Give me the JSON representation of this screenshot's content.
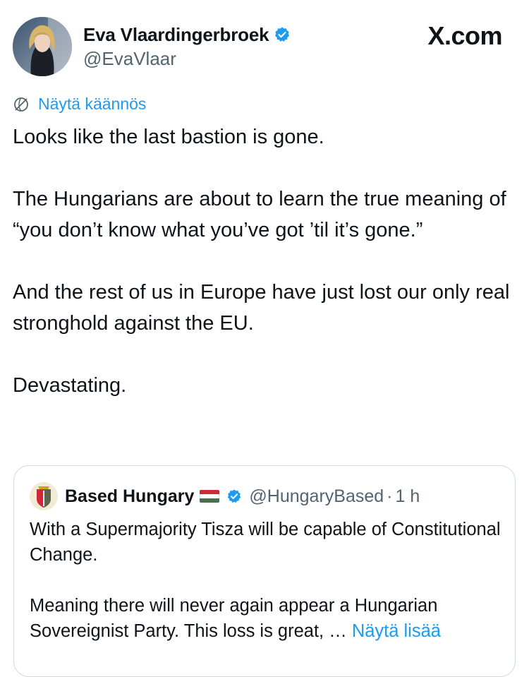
{
  "author": {
    "display_name": "Eva Vlaardingerbroek",
    "handle": "@EvaVlaar"
  },
  "site_label": "X.com",
  "translate_label": "Näytä käännös",
  "tweet": {
    "paragraphs": [
      "Looks like the last bastion is gone.",
      "The Hungarians are about to learn the true meaning of “you don’t know what you’ve got ’til it’s gone.”",
      "And the rest of us in Europe have just lost our only real stronghold against the EU.",
      "Devastating."
    ]
  },
  "quote": {
    "display_name": "Based Hungary",
    "handle": "@HungaryBased",
    "separator": "·",
    "time": "1 h",
    "paragraph_1": "With a Supermajority Tisza will be capable of Constitutional Change.",
    "paragraph_2": "Meaning there will never again appear a Hungarian Sovereignist Party. This loss is great, … ",
    "show_more": "Näytä lisää",
    "flag_colors": [
      "#ce2939",
      "#ffffff",
      "#477050"
    ]
  },
  "colors": {
    "accent": "#1d9bf0",
    "secondary_text": "#536471",
    "border": "#cfd9de"
  },
  "icons": {
    "verified": "verified-badge-icon",
    "translate": "translate-globe-icon",
    "flag": "hungary-flag-icon"
  }
}
